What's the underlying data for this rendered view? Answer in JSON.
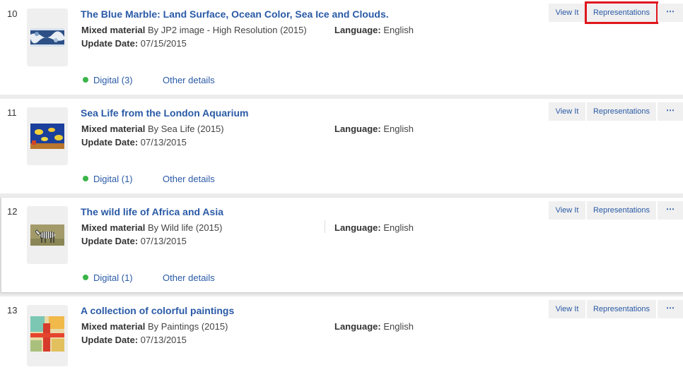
{
  "results": [
    {
      "number": "10",
      "title": "The Blue Marble: Land Surface, Ocean Color, Sea Ice and Clouds.",
      "material_label": "Mixed material",
      "by_text": " By JP2 image - High Resolution (2015)",
      "update_label": "Update Date:",
      "update_value": " 07/15/2015",
      "language_label": "Language:",
      "language_value": " English",
      "availability": "Digital (3)",
      "other_details": "Other details",
      "thumb_icon": "blue-marble-thumbnail"
    },
    {
      "number": "11",
      "title": "Sea Life from the London Aquarium",
      "material_label": "Mixed material",
      "by_text": " By Sea Life (2015)",
      "update_label": "Update Date:",
      "update_value": " 07/13/2015",
      "language_label": "Language:",
      "language_value": " English",
      "availability": "Digital (1)",
      "other_details": "Other details",
      "thumb_icon": "aquarium-fish-thumbnail"
    },
    {
      "number": "12",
      "title": "The wild life of Africa and Asia",
      "material_label": "Mixed material",
      "by_text": " By Wild life (2015)",
      "update_label": "Update Date:",
      "update_value": " 07/13/2015",
      "language_label": "Language:",
      "language_value": " English",
      "availability": "Digital (1)",
      "other_details": "Other details",
      "thumb_icon": "zebra-thumbnail"
    },
    {
      "number": "13",
      "title": "A collection of colorful paintings",
      "material_label": "Mixed material",
      "by_text": " By Paintings (2015)",
      "update_label": "Update Date:",
      "update_value": " 07/13/2015",
      "language_label": "Language:",
      "language_value": " English",
      "availability": "",
      "other_details": "",
      "thumb_icon": "abstract-painting-thumbnail"
    }
  ],
  "actions": {
    "view_it": "View It",
    "representations": "Representations",
    "more": "⋯"
  },
  "colors": {
    "link": "#2a5aa6",
    "available_dot": "#3bb54a",
    "highlight": "#e0161c"
  }
}
